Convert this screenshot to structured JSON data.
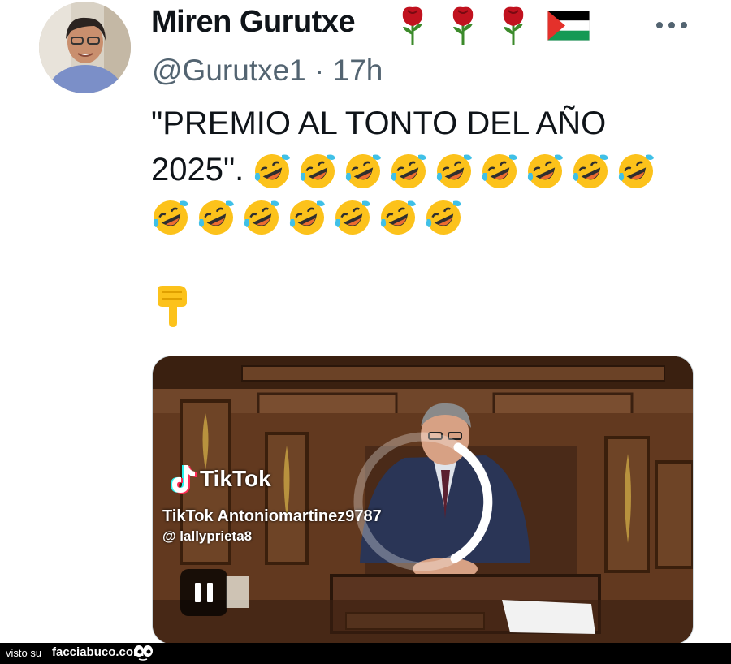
{
  "tweet": {
    "display_name": "Miren Gurutxe",
    "handle": "@Gurutxe1",
    "separator": "·",
    "time": "17h",
    "text_line1": "\"PREMIO AL TONTO DEL AÑO",
    "text_line2": "2025\". ",
    "laughing_emoji_count": 16,
    "name_emojis": [
      "rose-icon",
      "rose-icon",
      "rose-icon",
      "palestine-flag-icon"
    ],
    "pointer_emoji": "backhand-index-pointing-down-icon"
  },
  "video": {
    "watermark_brand": "TikTok",
    "watermark_user1": "TikTok    Antoniomartinez9787",
    "watermark_user2": "@ lallyprieta8",
    "state": "loading",
    "control_icon": "pause-icon"
  },
  "footer": {
    "visto_su": "visto su",
    "site": "facciabuco.com"
  },
  "colors": {
    "text": "#0f1419",
    "secondary": "#536471",
    "footer_bg": "#000000"
  }
}
